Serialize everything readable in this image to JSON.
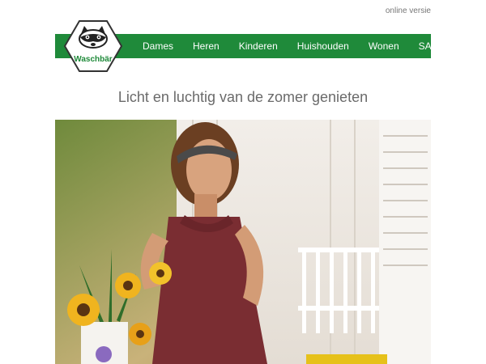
{
  "top_link": {
    "label": "online versie"
  },
  "brand": {
    "logo_text": "Waschbär"
  },
  "nav": {
    "items": [
      "Dames",
      "Heren",
      "Kinderen",
      "Huishouden",
      "Wonen",
      "SALE"
    ]
  },
  "headline": "Licht en luchtig van de zomer genieten",
  "hero": {
    "description_icon": "hero-photo"
  },
  "colors": {
    "brand_green": "#1f8a3a",
    "text_grey": "#6a6a6a",
    "link_grey": "#777777"
  }
}
